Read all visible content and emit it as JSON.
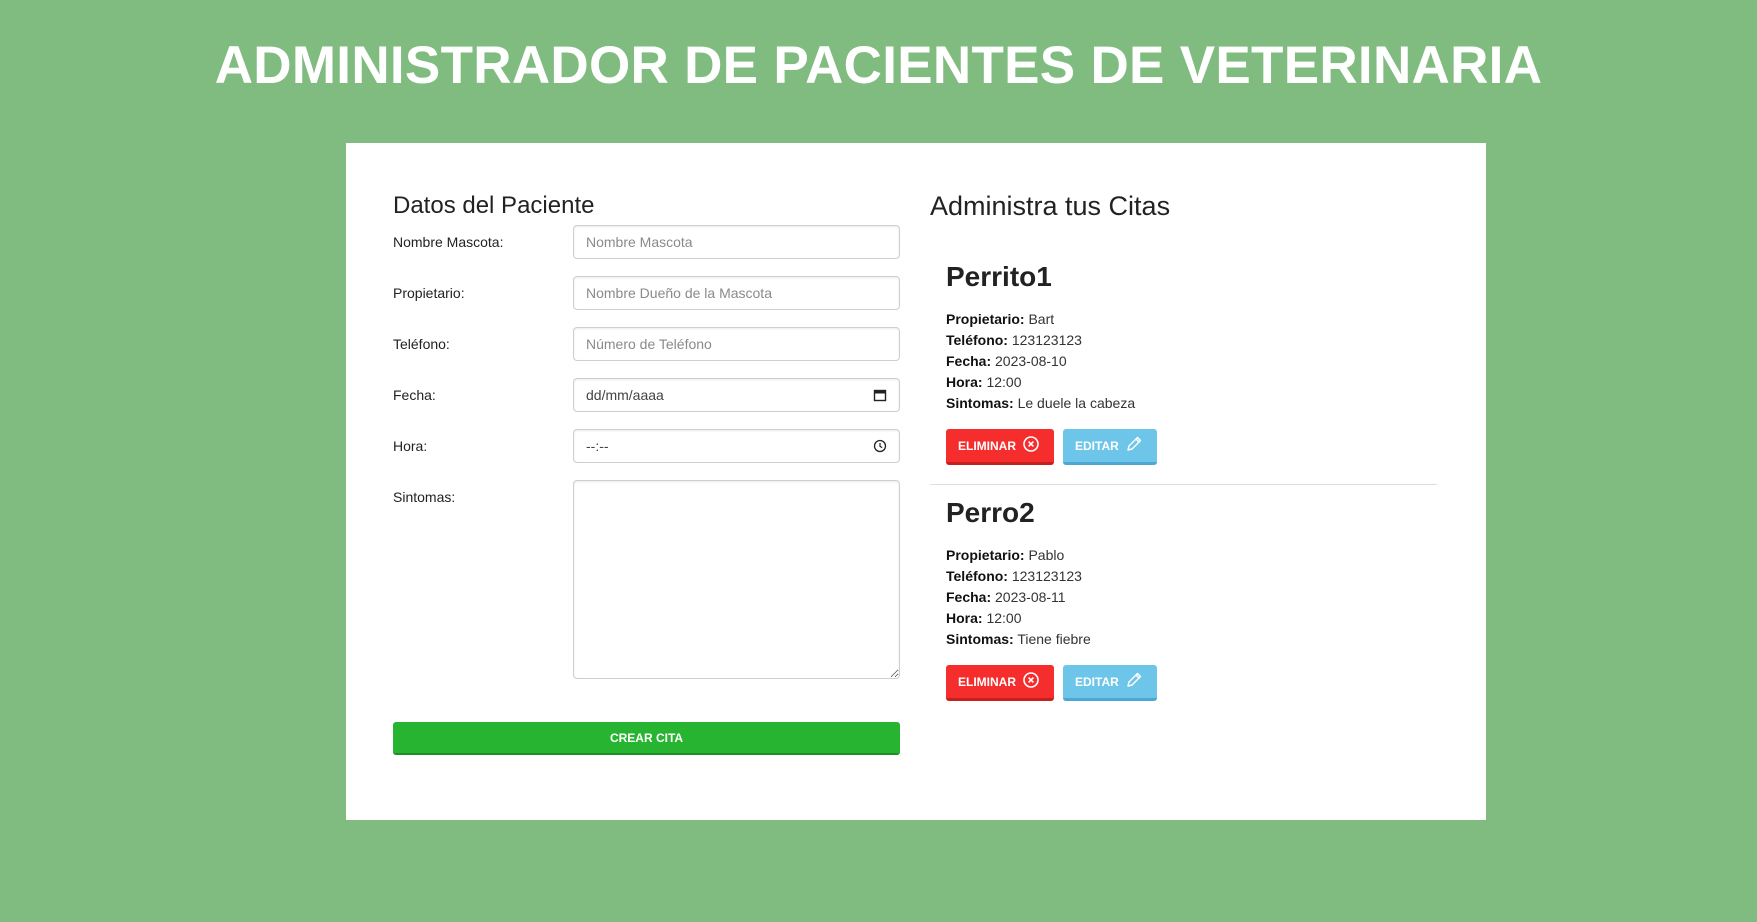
{
  "header": {
    "title": "ADMINISTRADOR DE PACIENTES DE VETERINARIA"
  },
  "form": {
    "title": "Datos del Paciente",
    "fields": {
      "mascota": {
        "label": "Nombre Mascota:",
        "placeholder": "Nombre Mascota",
        "value": ""
      },
      "propietario": {
        "label": "Propietario:",
        "placeholder": "Nombre Dueño de la Mascota",
        "value": ""
      },
      "telefono": {
        "label": "Teléfono:",
        "placeholder": "Número de Teléfono",
        "value": ""
      },
      "fecha": {
        "label": "Fecha:",
        "display": "dd/mm/aaaa",
        "icon": "calendar-icon"
      },
      "hora": {
        "label": "Hora:",
        "display": "--:--",
        "icon": "clock-icon"
      },
      "sintomas": {
        "label": "Sintomas:",
        "value": ""
      }
    },
    "submit_label": "CREAR CITA"
  },
  "citas": {
    "title": "Administra tus Citas",
    "labels": {
      "propietario": "Propietario:",
      "telefono": "Teléfono:",
      "fecha": "Fecha:",
      "hora": "Hora:",
      "sintomas": "Sintomas:"
    },
    "items": [
      {
        "mascota": "Perrito1",
        "propietario": "Bart",
        "telefono": "123123123",
        "fecha": "2023-08-10",
        "hora": "12:00",
        "sintomas": "Le duele la cabeza",
        "delete_label": "ELIMINAR",
        "edit_label": "EDITAR"
      },
      {
        "mascota": "Perro2",
        "propietario": "Pablo",
        "telefono": "123123123",
        "fecha": "2023-08-11",
        "hora": "12:00",
        "sintomas": "Tiene fiebre",
        "delete_label": "ELIMINAR",
        "edit_label": "EDITAR"
      }
    ]
  },
  "colors": {
    "background": "#80bc80",
    "create_button": "#27b531",
    "delete_button": "#f62d2d",
    "edit_button": "#6dc6ea"
  }
}
